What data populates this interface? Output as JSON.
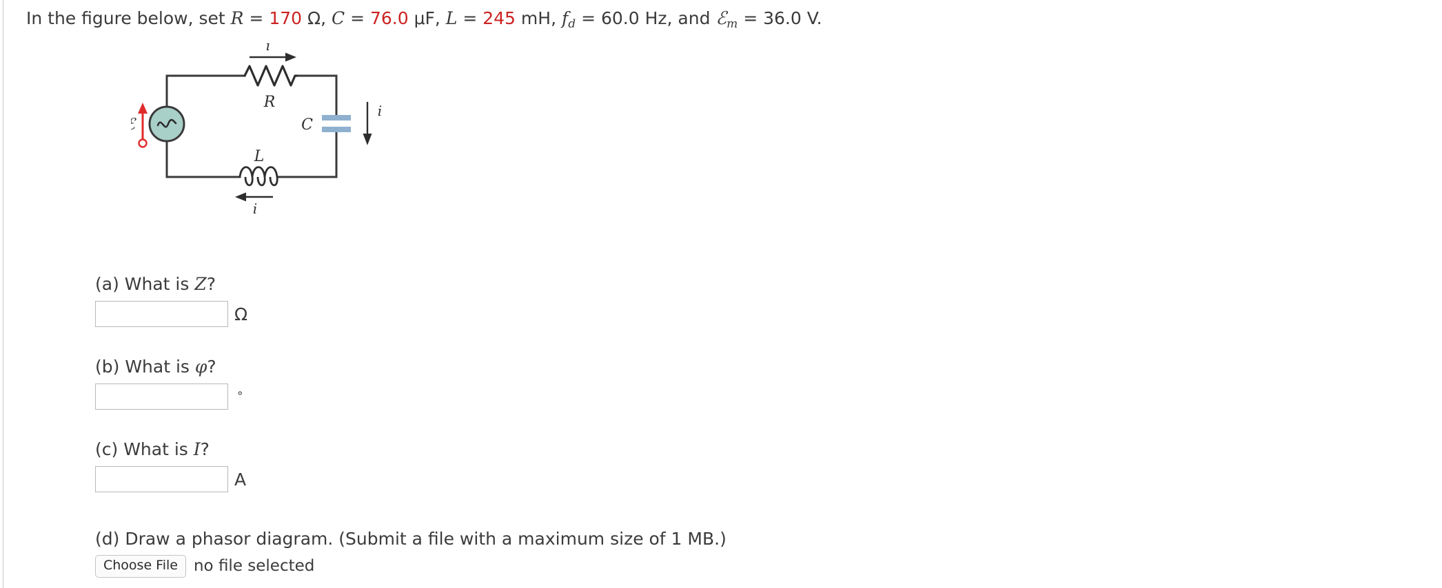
{
  "problem": {
    "intro": "In the figure below, set ",
    "terms": [
      {
        "symbol": "R",
        "eq": " = ",
        "value": "170",
        "unit": " Ω, ",
        "highlight": true
      },
      {
        "symbol": "C",
        "eq": " = ",
        "value": "76.0",
        "unit": " μF, ",
        "highlight": true
      },
      {
        "symbol": "L",
        "eq": " = ",
        "value": "245",
        "unit": " mH, ",
        "highlight": true
      },
      {
        "symbol": "f",
        "subscript": "d",
        "eq": " = ",
        "value": "60.0",
        "unit": " Hz, and ",
        "highlight": false
      },
      {
        "symbol": "ℰ",
        "subscript": "m",
        "eq": " = ",
        "value": "36.0",
        "unit": " V.",
        "highlight": false
      }
    ],
    "full_text": "In the figure below, set R = 170 Ω, C = 76.0 μF, L = 245 mH, f_d = 60.0 Hz, and ℰ_m = 36.0 V."
  },
  "figure": {
    "name": "rlc-series-circuit",
    "labels": {
      "resistor": "R",
      "capacitor": "C",
      "inductor": "L",
      "emf": "ℰ",
      "current_top": "i",
      "current_right": "i",
      "current_bottom": "i"
    },
    "colors": {
      "wire": "#3a3a3a",
      "source_fill": "#a9cfc9",
      "source_stroke": "#3a3a3a",
      "emf_arrow": "#e02b2b",
      "capacitor_plate": "#8fb0cf"
    }
  },
  "questions": [
    {
      "label_prefix": "(a) What is ",
      "variable": "Z",
      "label_suffix": "?",
      "value": "",
      "placeholder": "",
      "unit": "Ω",
      "unit_style": "normal"
    },
    {
      "label_prefix": "(b) What is ",
      "variable": "φ",
      "label_suffix": "?",
      "value": "",
      "placeholder": "",
      "unit": "°",
      "unit_style": "degree"
    },
    {
      "label_prefix": "(c) What is ",
      "variable": "I",
      "label_suffix": "?",
      "value": "",
      "placeholder": "",
      "unit": "A",
      "unit_style": "normal"
    }
  ],
  "file_upload": {
    "prompt": "(d) Draw a phasor diagram. (Submit a file with a maximum size of 1 MB.)",
    "button_label": "Choose File",
    "status": "no file selected"
  }
}
